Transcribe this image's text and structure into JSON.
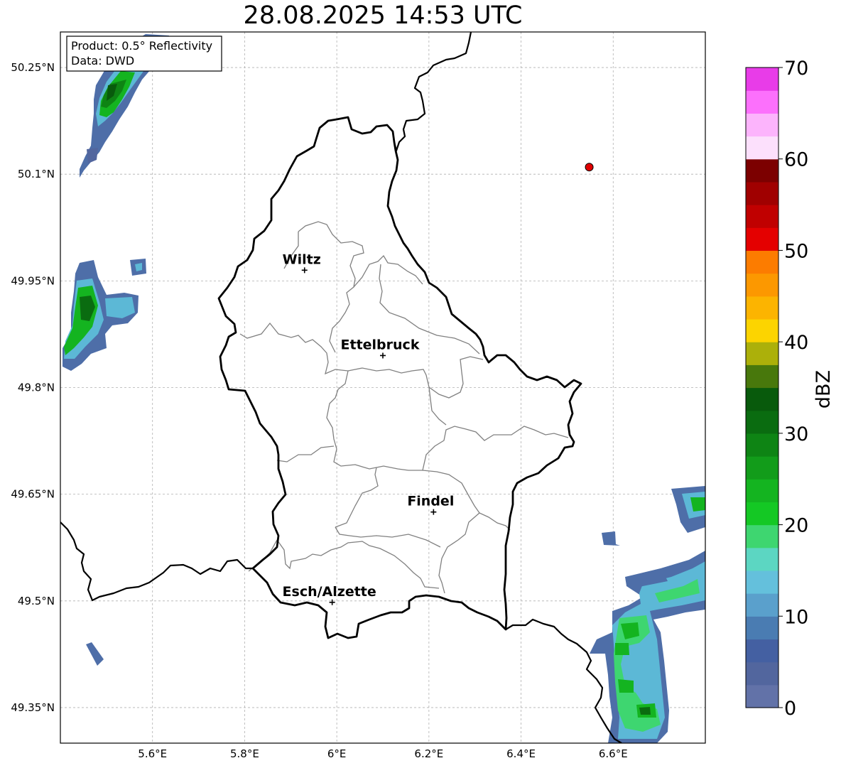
{
  "title": "28.08.2025 14:53 UTC",
  "info": {
    "product": "Product: 0.5° Reflectivity",
    "data": "Data: DWD"
  },
  "map": {
    "lon_range": [
      5.4,
      6.8
    ],
    "lat_range": [
      49.3,
      50.3
    ],
    "lat_ticks": [
      {
        "value": 50.25,
        "label": "50.25°N"
      },
      {
        "value": 50.1,
        "label": "50.1°N"
      },
      {
        "value": 49.95,
        "label": "49.95°N"
      },
      {
        "value": 49.8,
        "label": "49.8°N"
      },
      {
        "value": 49.65,
        "label": "49.65°N"
      },
      {
        "value": 49.5,
        "label": "49.5°N"
      },
      {
        "value": 49.35,
        "label": "49.35°N"
      }
    ],
    "lon_ticks": [
      {
        "value": 5.6,
        "label": "5.6°E"
      },
      {
        "value": 5.8,
        "label": "5.8°E"
      },
      {
        "value": 6.0,
        "label": "6°E"
      },
      {
        "value": 6.2,
        "label": "6.2°E"
      },
      {
        "value": 6.4,
        "label": "6.4°E"
      },
      {
        "value": 6.6,
        "label": "6.6°E"
      }
    ],
    "cities": [
      {
        "name": "Wiltz",
        "lon": 5.93,
        "lat": 49.965
      },
      {
        "name": "Ettelbruck",
        "lon": 6.1,
        "lat": 49.845
      },
      {
        "name": "Findel",
        "lon": 6.21,
        "lat": 49.625
      },
      {
        "name": "Esch/Alzette",
        "lon": 5.99,
        "lat": 49.498
      }
    ],
    "radar_site": {
      "lon": 6.548,
      "lat": 50.11,
      "color": "#e00000"
    }
  },
  "colorbar": {
    "label": "dBZ",
    "min": 0,
    "max": 70,
    "ticks": [
      "0",
      "10",
      "20",
      "30",
      "40",
      "50",
      "60",
      "70"
    ],
    "colors": [
      "#6272a8",
      "#52669e",
      "#4460a2",
      "#4a7cb2",
      "#5aa0cc",
      "#64c0dc",
      "#5cd6c2",
      "#3ed670",
      "#14c824",
      "#14b420",
      "#129c1a",
      "#0e8414",
      "#0a6c10",
      "#085a0c",
      "#48780c",
      "#acb00a",
      "#fcd400",
      "#fcb400",
      "#fc9800",
      "#fc7c00",
      "#e40000",
      "#c00000",
      "#a00000",
      "#7c0000",
      "#fce0fc",
      "#fcb4fc",
      "#fc70fc",
      "#e83ce8"
    ]
  }
}
